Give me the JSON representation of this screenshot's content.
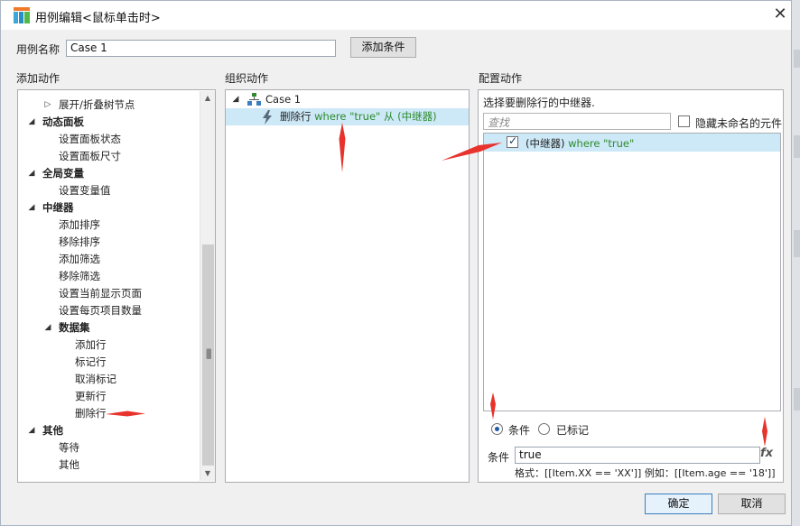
{
  "window": {
    "title": "用例编辑<鼠标单击时>"
  },
  "case_name": {
    "label": "用例名称",
    "value": "Case 1"
  },
  "add_condition_button": "添加条件",
  "sections": {
    "add_actions": "添加动作",
    "organize_actions": "组织动作",
    "configure_actions": "配置动作"
  },
  "actions_tree": [
    {
      "text": "展开/折叠树节点",
      "level": 1,
      "bold": false,
      "toggle": "collapsed"
    },
    {
      "text": "动态面板",
      "level": 0,
      "bold": true,
      "toggle": "expanded"
    },
    {
      "text": "设置面板状态",
      "level": 1,
      "bold": false
    },
    {
      "text": "设置面板尺寸",
      "level": 1,
      "bold": false
    },
    {
      "text": "全局变量",
      "level": 0,
      "bold": true,
      "toggle": "expanded"
    },
    {
      "text": "设置变量值",
      "level": 1,
      "bold": false
    },
    {
      "text": "中继器",
      "level": 0,
      "bold": true,
      "toggle": "expanded"
    },
    {
      "text": "添加排序",
      "level": 1,
      "bold": false
    },
    {
      "text": "移除排序",
      "level": 1,
      "bold": false
    },
    {
      "text": "添加筛选",
      "level": 1,
      "bold": false
    },
    {
      "text": "移除筛选",
      "level": 1,
      "bold": false
    },
    {
      "text": "设置当前显示页面",
      "level": 1,
      "bold": false
    },
    {
      "text": "设置每页项目数量",
      "level": 1,
      "bold": false
    },
    {
      "text": "数据集",
      "level": 1,
      "bold": true,
      "toggle": "expanded"
    },
    {
      "text": "添加行",
      "level": 2,
      "bold": false
    },
    {
      "text": "标记行",
      "level": 2,
      "bold": false
    },
    {
      "text": "取消标记",
      "level": 2,
      "bold": false
    },
    {
      "text": "更新行",
      "level": 2,
      "bold": false
    },
    {
      "text": "删除行",
      "level": 2,
      "bold": false
    },
    {
      "text": "其他",
      "level": 0,
      "bold": true,
      "toggle": "expanded"
    },
    {
      "text": "等待",
      "level": 1,
      "bold": false
    },
    {
      "text": "其他",
      "level": 1,
      "bold": false
    }
  ],
  "organize": {
    "case_label": "Case 1",
    "action": {
      "verb": "删除行",
      "cond": "where \"true\"",
      "from": "从",
      "target": "(中继器)"
    }
  },
  "configure": {
    "prompt": "选择要删除行的中继器.",
    "search_placeholder": "查找",
    "hide_unnamed_label": "隐藏未命名的元件",
    "repeater_item": {
      "name": "(中继器)",
      "cond": "where \"true\"",
      "checked": true
    },
    "radio_condition": "条件",
    "radio_marked": "已标记",
    "condition_label": "条件",
    "condition_value": "true",
    "fx_label": "fx",
    "format_hint": "格式：[[Item.XX == 'XX']] 例如：[[Item.age == '18']]"
  },
  "footer": {
    "ok": "确定",
    "cancel": "取消"
  },
  "colors": {
    "selection": "#cde8f7",
    "accent_green": "#2e8b2e",
    "arrow_red": "#e8322c"
  }
}
